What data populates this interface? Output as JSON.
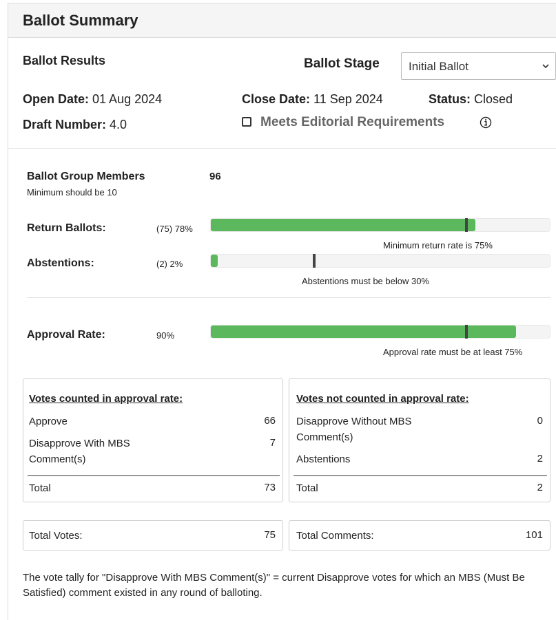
{
  "header": {
    "title": "Ballot Summary"
  },
  "results": {
    "title": "Ballot Results",
    "stage_label": "Ballot Stage",
    "stage_value": "Initial Ballot",
    "open_date_label": "Open Date:",
    "open_date": "01 Aug 2024",
    "close_date_label": "Close Date:",
    "close_date": "11 Sep 2024",
    "status_label": "Status:",
    "status": "Closed",
    "draft_label": "Draft Number:",
    "draft": "4.0",
    "meets_label": "Meets Editorial Requirements",
    "meets_checked": false
  },
  "metrics": {
    "members_label": "Ballot Group Members",
    "members_value": "96",
    "members_note": "Minimum should be 10",
    "return_label": "Return Ballots:",
    "return_value": "(75) 78%",
    "return_fill": 0.78,
    "return_threshold": 0.75,
    "return_caption": "Minimum return rate is 75%",
    "abst_label": "Abstentions:",
    "abst_value": "(2) 2%",
    "abst_fill": 0.02,
    "abst_threshold": 0.3,
    "abst_caption": "Abstentions must be below 30%",
    "approval_label": "Approval Rate:",
    "approval_value": "90%",
    "approval_fill": 0.9,
    "approval_threshold": 0.75,
    "approval_caption": "Approval rate must be at least 75%"
  },
  "counted": {
    "title": "Votes counted in approval rate:",
    "approve_label": "Approve",
    "approve": "66",
    "disapprove_mbs_label": "Disapprove With MBS Comment(s)",
    "disapprove_mbs": "7",
    "total_label": "Total",
    "total": "73"
  },
  "not_counted": {
    "title": "Votes not counted in approval rate:",
    "disapprove_no_mbs_label": "Disapprove Without MBS Comment(s)",
    "disapprove_no_mbs": "0",
    "abstentions_label": "Abstentions",
    "abstentions": "2",
    "total_label": "Total",
    "total": "2"
  },
  "totals": {
    "votes_label": "Total Votes:",
    "votes": "75",
    "comments_label": "Total Comments:",
    "comments": "101"
  },
  "footnote": "The vote tally for \"Disapprove With MBS Comment(s)\" = current Disapprove votes for which an MBS (Must Be Satisfied) comment existed in any round of balloting.",
  "colors": {
    "bar_fill": "#5cb85c",
    "bar_track": "#f4f4f4",
    "marker": "#444444"
  }
}
